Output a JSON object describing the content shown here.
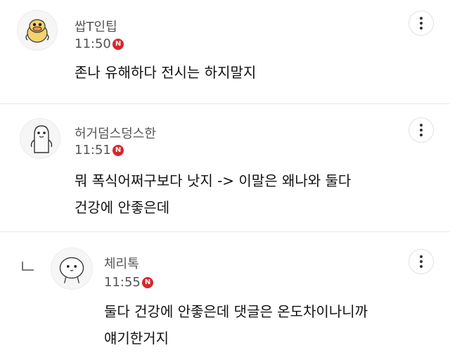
{
  "comments": [
    {
      "author": "쌉T인팁",
      "time": "11:50",
      "badge": "N",
      "text_lines": [
        "존나 유해하다 전시는 하지말지"
      ],
      "avatar": "duck-avatar"
    },
    {
      "author": "허거덤스덩스한",
      "time": "11:51",
      "badge": "N",
      "text_lines": [
        "뭐 폭식어쩌구보다 낫지 -> 이말은 왜나와 둘다",
        "건강에 안좋은데"
      ],
      "avatar": "penguin-avatar"
    },
    {
      "author": "체리톡",
      "time": "11:55",
      "badge": "N",
      "text_lines": [
        "둘다 건강에 안좋은데 댓글은 온도차이나니까",
        "얘기한거지"
      ],
      "avatar": "blob-avatar",
      "is_reply": true
    }
  ],
  "icons": {
    "more": "more-vertical-icon",
    "reply": "reply-arrow-icon",
    "new": "new-badge-icon"
  },
  "colors": {
    "badge": "#d8272b",
    "meta_text": "#555555",
    "divider": "#e6e6e6"
  }
}
